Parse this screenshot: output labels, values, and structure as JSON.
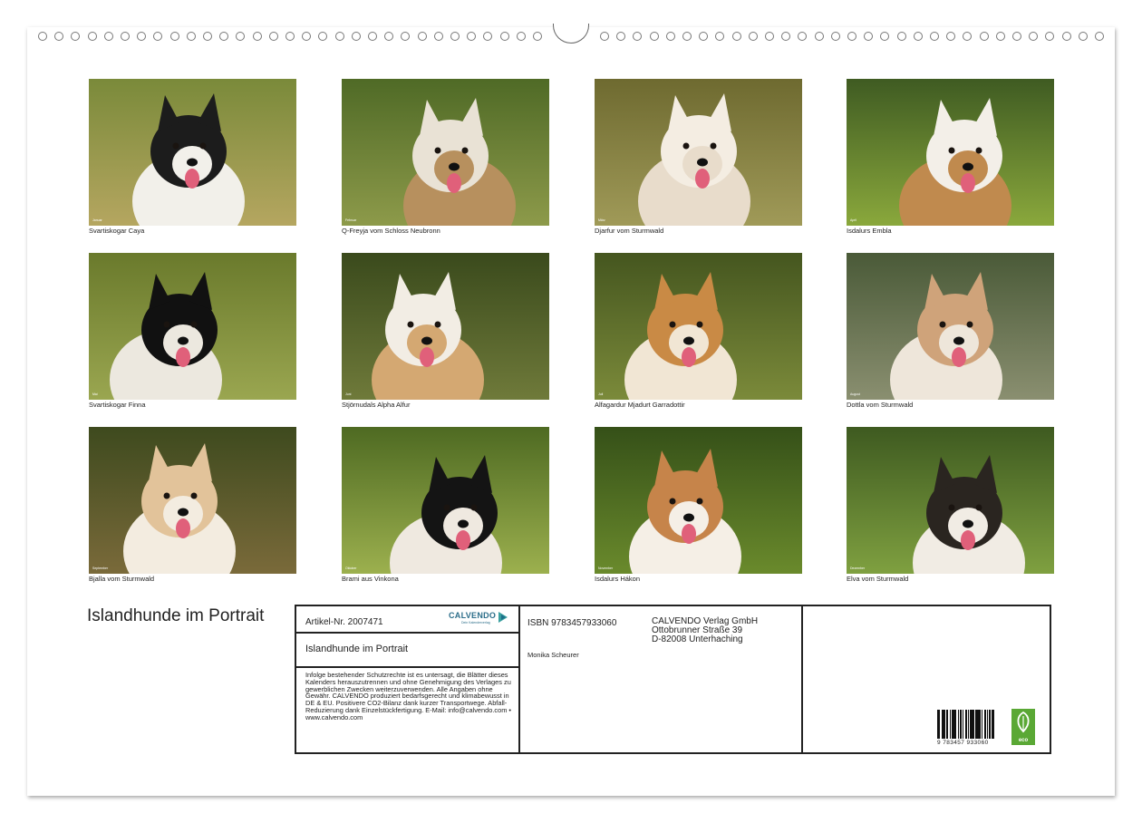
{
  "document": {
    "title": "Islandhunde im Portrait"
  },
  "photos": [
    {
      "caption": "Svartiskogar Caya",
      "month": "Januar",
      "palette": {
        "bg": "#7a8a3a",
        "bg2": "#b5a660",
        "fur": "#1c1c1c",
        "fur2": "#f2f0ea"
      }
    },
    {
      "caption": "Q-Freyja vom Schloss Neubronn",
      "month": "Februar",
      "palette": {
        "bg": "#4f6a26",
        "bg2": "#8d9a4a",
        "fur": "#e9e2d5",
        "fur2": "#b7905e"
      }
    },
    {
      "caption": "Djarfur vom Sturmwald",
      "month": "März",
      "palette": {
        "bg": "#6e6a30",
        "bg2": "#a09a58",
        "fur": "#f4ede2",
        "fur2": "#e8dccb"
      }
    },
    {
      "caption": "Isdalurs Embla",
      "month": "April",
      "palette": {
        "bg": "#3f5b22",
        "bg2": "#8aa83c",
        "fur": "#f3efe8",
        "fur2": "#c08a4e"
      }
    },
    {
      "caption": "Svartiskogar Finna",
      "month": "Mai",
      "palette": {
        "bg": "#6a7a2c",
        "bg2": "#9aa650",
        "fur": "#111111",
        "fur2": "#ece8df"
      }
    },
    {
      "caption": "Stjörnudals Alpha Alfur",
      "month": "Juni",
      "palette": {
        "bg": "#3a4a1c",
        "bg2": "#6f7a3a",
        "fur": "#f2ede4",
        "fur2": "#d4a872"
      }
    },
    {
      "caption": "Alfagardur Mjadurt Garradottir",
      "month": "Juli",
      "palette": {
        "bg": "#45561f",
        "bg2": "#7b8a3a",
        "fur": "#c98a45",
        "fur2": "#f1e6d4"
      }
    },
    {
      "caption": "Dottla vom Sturmwald",
      "month": "August",
      "palette": {
        "bg": "#4a5a38",
        "bg2": "#8a8f70",
        "fur": "#cfa37a",
        "fur2": "#eee6da"
      }
    },
    {
      "caption": "Bjalla vom Sturmwald",
      "month": "September",
      "palette": {
        "bg": "#3e4a1e",
        "bg2": "#7a6a3a",
        "fur": "#e2c39a",
        "fur2": "#f3ece0"
      }
    },
    {
      "caption": "Brami aus Vinkona",
      "month": "Oktober",
      "palette": {
        "bg": "#4e6a22",
        "bg2": "#9cb04e",
        "fur": "#141414",
        "fur2": "#efe9e0"
      }
    },
    {
      "caption": "Isdalurs Hákon",
      "month": "November",
      "palette": {
        "bg": "#355018",
        "bg2": "#6a8a2c",
        "fur": "#c6844a",
        "fur2": "#f5efe6"
      }
    },
    {
      "caption": "Elva vom Sturmwald",
      "month": "Dezember",
      "palette": {
        "bg": "#3e5a20",
        "bg2": "#7fa040",
        "fur": "#2a2520",
        "fur2": "#f1ece4"
      }
    }
  ],
  "imprint": {
    "article_nr": "Artikel-Nr. 2007471",
    "brand": "CALVENDO",
    "brand_sub": "Dein Kalenderverlag",
    "book_title": "Islandhunde im Portrait",
    "legal_text": "Infolge bestehender Schutzrechte ist es untersagt, die Blätter dieses Kalenders herauszutrennen und ohne Genehmigung des Verlages zu gewerblichen Zwecken weiterzuverwenden. Alle Angaben ohne Gewähr. CALVENDO produziert bedarfsgerecht und klimabewusst in DE & EU. Positivere CO2-Bilanz dank kurzer Transportwege. Abfall-Reduzierung dank Einzelstückfertigung. E-Mail: info@calvendo.com • www.calvendo.com",
    "isbn": "ISBN 9783457933060",
    "publisher_name": "CALVENDO Verlag GmbH",
    "publisher_street": "Ottobrunner Straße 39",
    "publisher_city": "D-82008 Unterhaching",
    "author": "Monika Scheurer",
    "barcode_number": "9 783457 933060",
    "eco_label": "eco"
  }
}
